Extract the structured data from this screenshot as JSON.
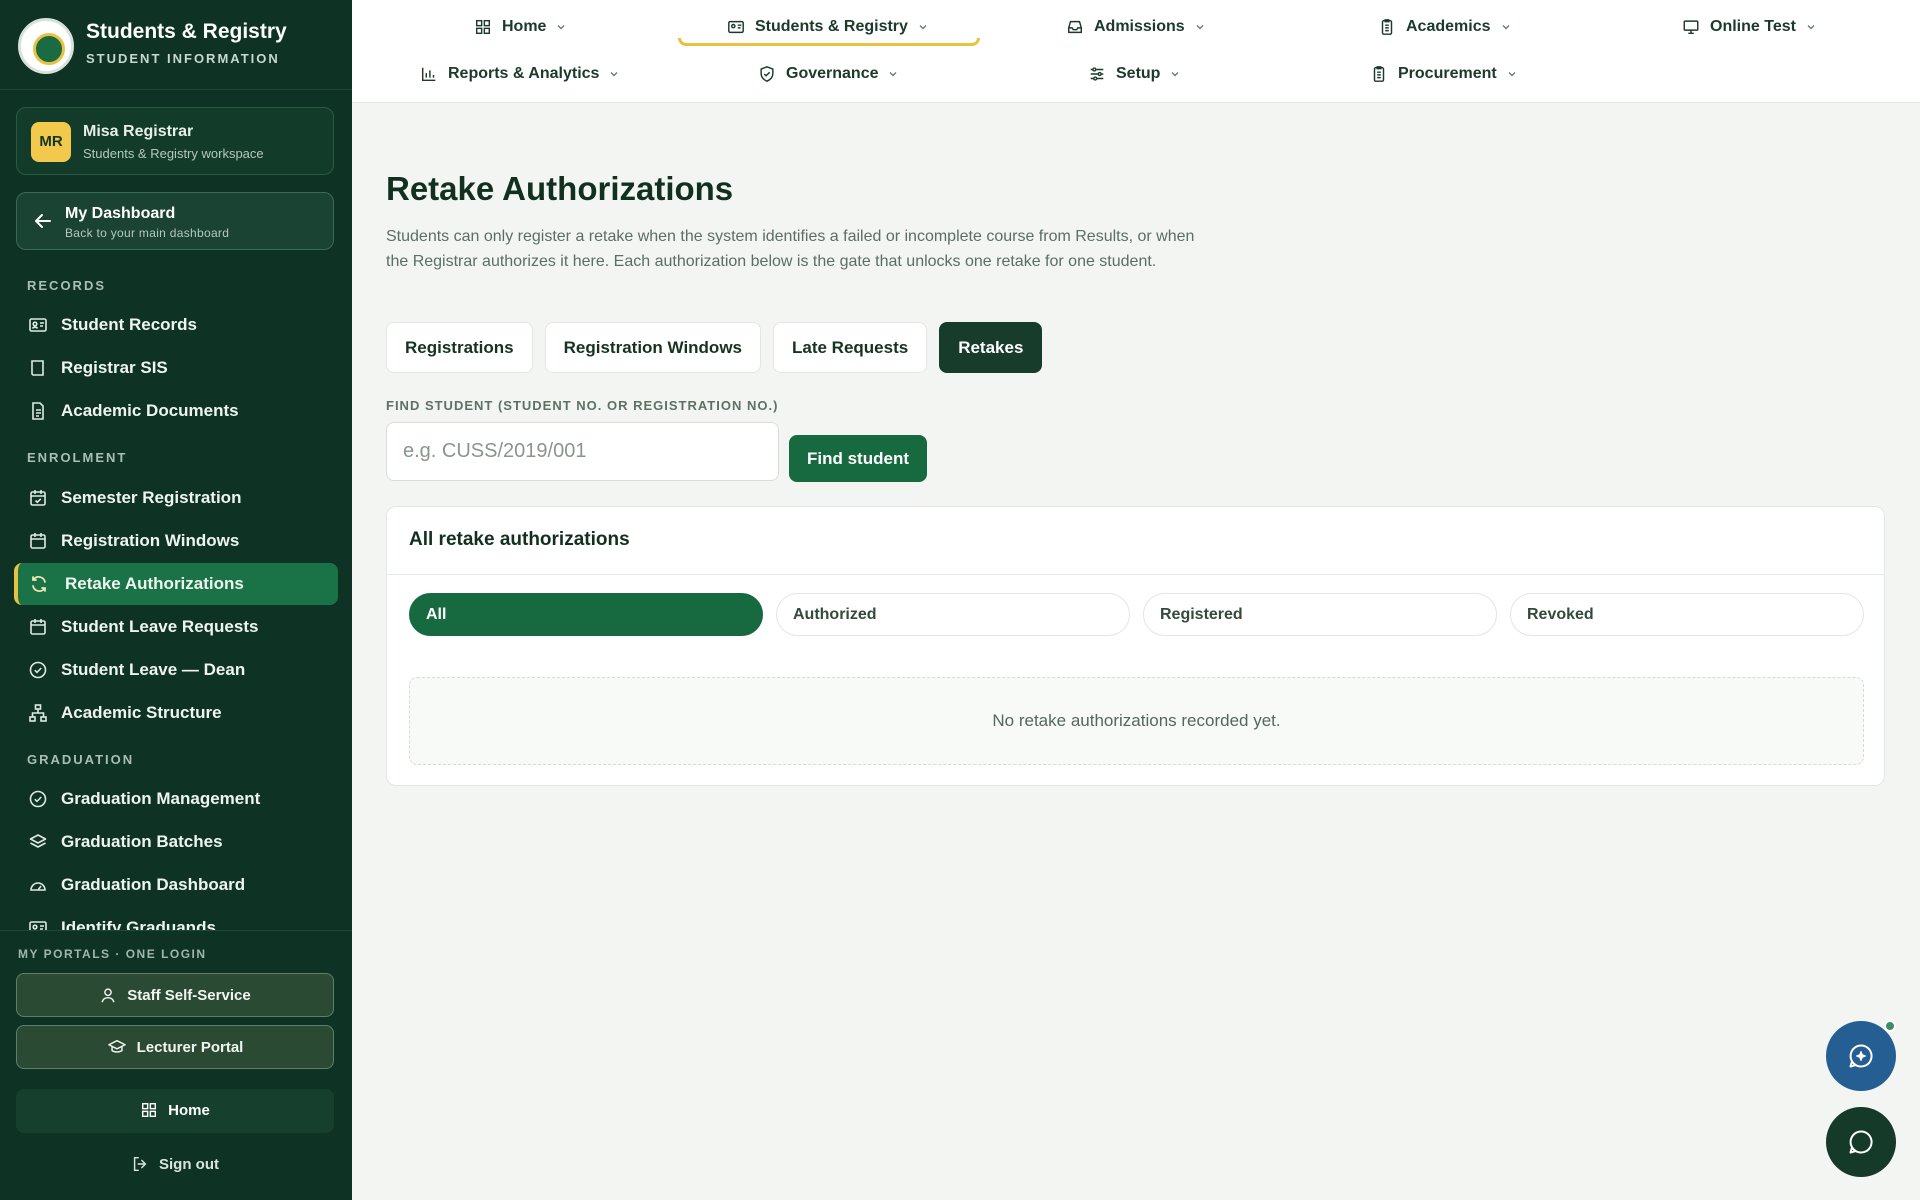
{
  "brand": {
    "title": "Students & Registry",
    "subtitle": "STUDENT INFORMATION"
  },
  "user": {
    "initials": "MR",
    "name": "Misa Registrar",
    "workspace": "Students & Registry workspace"
  },
  "dashboard": {
    "title": "My Dashboard",
    "subtitle": "Back to your main dashboard"
  },
  "sidebar": {
    "sections": [
      {
        "label": "RECORDS",
        "items": [
          {
            "label": "Student Records",
            "icon": "id-card-icon"
          },
          {
            "label": "Registrar SIS",
            "icon": "book-icon"
          },
          {
            "label": "Academic Documents",
            "icon": "document-icon"
          }
        ]
      },
      {
        "label": "ENROLMENT",
        "items": [
          {
            "label": "Semester Registration",
            "icon": "calendar-check-icon"
          },
          {
            "label": "Registration Windows",
            "icon": "calendar-icon"
          },
          {
            "label": "Retake Authorizations",
            "icon": "refresh-icon",
            "active": true
          },
          {
            "label": "Student Leave Requests",
            "icon": "calendar-icon"
          },
          {
            "label": "Student Leave — Dean",
            "icon": "check-circle-icon"
          },
          {
            "label": "Academic Structure",
            "icon": "hierarchy-icon"
          }
        ]
      },
      {
        "label": "GRADUATION",
        "items": [
          {
            "label": "Graduation Management",
            "icon": "check-circle-icon"
          },
          {
            "label": "Graduation Batches",
            "icon": "layers-icon"
          },
          {
            "label": "Graduation Dashboard",
            "icon": "gauge-icon"
          },
          {
            "label": "Identify Graduands",
            "icon": "id-card-icon"
          }
        ]
      }
    ]
  },
  "portals": {
    "label": "MY PORTALS · ONE LOGIN",
    "staff": "Staff Self-Service",
    "lecturer": "Lecturer Portal",
    "home": "Home",
    "signout": "Sign out"
  },
  "topnav": {
    "home": "Home",
    "students": "Students & Registry",
    "admissions": "Admissions",
    "academics": "Academics",
    "online_test": "Online Test",
    "reports": "Reports & Analytics",
    "governance": "Governance",
    "setup": "Setup",
    "procurement": "Procurement"
  },
  "page": {
    "title": "Retake Authorizations",
    "description": "Students can only register a retake when the system identifies a failed or incomplete course from Results, or when the Registrar authorizes it here. Each authorization below is the gate that unlocks one retake for one student.",
    "tabs": [
      "Registrations",
      "Registration Windows",
      "Late Requests",
      "Retakes"
    ],
    "find_label": "FIND STUDENT (STUDENT NO. OR REGISTRATION NO.)",
    "find_placeholder": "e.g. CUSS/2019/001",
    "find_button": "Find student",
    "card_title": "All retake authorizations",
    "filters": [
      "All",
      "Authorized",
      "Registered",
      "Revoked"
    ],
    "empty_message": "No retake authorizations recorded yet."
  },
  "colors": {
    "sidebar_bg": "#0e3324",
    "accent_green": "#17693f",
    "accent_gold": "#e8c242",
    "fab_blue": "#255e93"
  }
}
